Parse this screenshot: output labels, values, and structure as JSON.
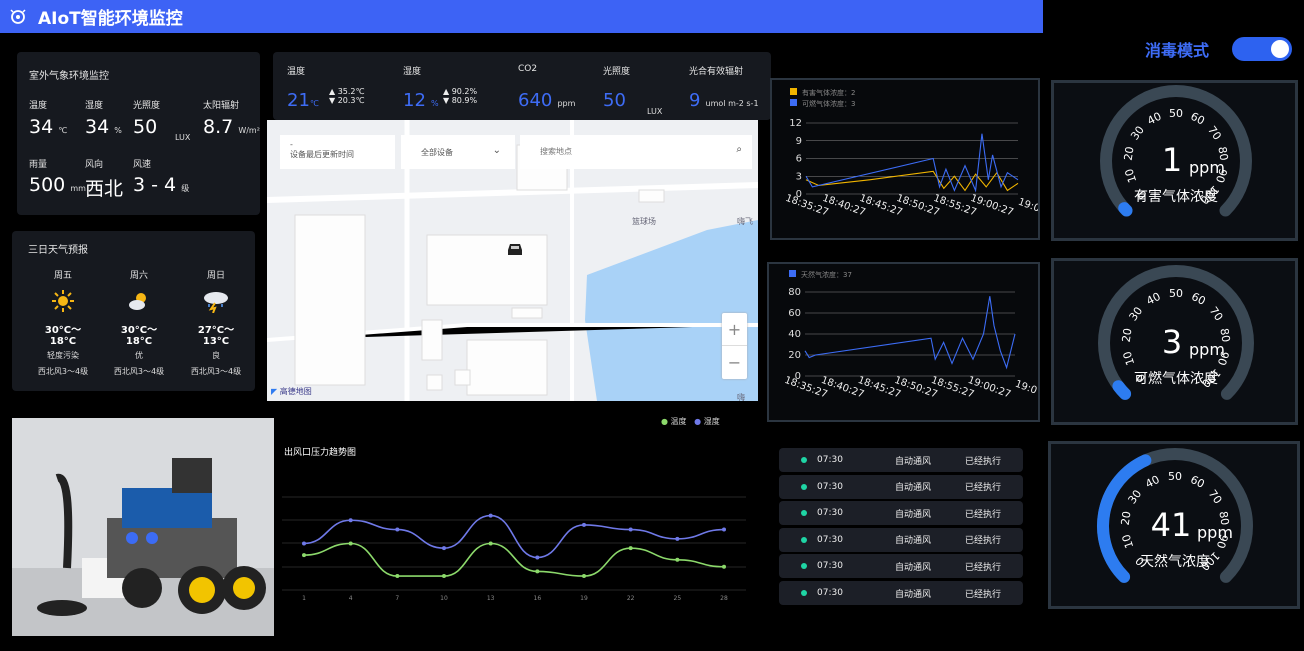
{
  "app": {
    "title": "AIoT智能环境监控"
  },
  "disinfect": {
    "label": "消毒模式",
    "on": true
  },
  "outdoor": {
    "title": "室外气象环境监控",
    "items": [
      {
        "label": "温度",
        "value": "34",
        "unit": "℃"
      },
      {
        "label": "湿度",
        "value": "34",
        "unit": "%"
      },
      {
        "label": "光照度",
        "value": "50",
        "unit": "LUX"
      },
      {
        "label": "太阳辐射",
        "value": "8.7",
        "unit": "W/m²"
      },
      {
        "label": "雨量",
        "value": "500",
        "unit": "mm"
      },
      {
        "label": "风向",
        "value": "西北",
        "unit": ""
      },
      {
        "label": "风速",
        "value": "3 - 4",
        "unit": "级"
      }
    ]
  },
  "forecast": {
    "title": "三日天气预报",
    "days": [
      {
        "day": "周五",
        "icon": "sun-icon",
        "temp": "30°C～18°C",
        "quality": "轻度污染",
        "wind": "西北风3～4级"
      },
      {
        "day": "周六",
        "icon": "partly-cloudy-icon",
        "temp": "30°C～18°C",
        "quality": "优",
        "wind": "西北风3～4级"
      },
      {
        "day": "周日",
        "icon": "thunderstorm-icon",
        "temp": "27°C～13°C",
        "quality": "良",
        "wind": "西北风3～4级"
      }
    ]
  },
  "sensors": {
    "temp": {
      "label": "温度",
      "value": "21",
      "unit": "℃",
      "high": "35.2℃",
      "low": "20.3℃"
    },
    "humidity": {
      "label": "湿度",
      "value": "12",
      "unit": "%",
      "high": "90.2%",
      "low": "80.9%"
    },
    "co2": {
      "label": "CO2",
      "value": "640",
      "unit": "ppm"
    },
    "light": {
      "label": "光照度",
      "value": "50",
      "unit": "LUX"
    },
    "par": {
      "label": "光合有效辐射",
      "value": "9",
      "unit": "umol m-2 s-1"
    }
  },
  "map": {
    "time_dash": "-",
    "time_label": "设备最后更新时间",
    "device_select": "全部设备",
    "search_placeholder": "搜索地点",
    "place1": "篮球场",
    "place2": "嗨飞",
    "place3": "嗨",
    "logo": "高德地图"
  },
  "pressure": {
    "title": "出风口压力趋势图",
    "legend": [
      "温度",
      "湿度"
    ]
  },
  "gas_chart": {
    "legend": [
      "有害气体浓度：2",
      "可燃气体浓度：3"
    ],
    "yticks": [
      "12",
      "9",
      "6",
      "3",
      "0"
    ],
    "xticks": [
      "18:35:27",
      "18:40:27",
      "18:45:27",
      "18:50:27",
      "18:55:27",
      "19:00:27",
      "19:0"
    ]
  },
  "natural_chart": {
    "legend": [
      "天然气浓度：37"
    ],
    "yticks": [
      "80",
      "60",
      "40",
      "20",
      "0"
    ],
    "xticks": [
      "18:35:27",
      "18:40:27",
      "18:45:27",
      "18:50:27",
      "18:55:27",
      "19:00:27",
      "19:0"
    ]
  },
  "logs": [
    {
      "time": "07:30",
      "action": "自动通风",
      "status": "已经执行"
    },
    {
      "time": "07:30",
      "action": "自动通风",
      "status": "已经执行"
    },
    {
      "time": "07:30",
      "action": "自动通风",
      "status": "已经执行"
    },
    {
      "time": "07:30",
      "action": "自动通风",
      "status": "已经执行"
    },
    {
      "time": "07:30",
      "action": "自动通风",
      "status": "已经执行"
    },
    {
      "time": "07:30",
      "action": "自动通风",
      "status": "已经执行"
    }
  ],
  "gauges": [
    {
      "value": "1",
      "unit": "ppm",
      "label": "有害气体浓度",
      "fraction": 0.01
    },
    {
      "value": "3",
      "unit": "ppm",
      "label": "可燃气体浓度",
      "fraction": 0.03
    },
    {
      "value": "41",
      "unit": "ppm",
      "label": "天然气浓度",
      "fraction": 0.41
    }
  ],
  "gauge_ticks": [
    "0",
    "10",
    "20",
    "30",
    "40",
    "50",
    "60",
    "70",
    "80",
    "90",
    "100"
  ],
  "chart_data": [
    {
      "type": "line",
      "title": "出风口压力趋势图",
      "x": [
        1,
        4,
        7,
        10,
        13,
        16,
        19,
        22,
        25,
        28
      ],
      "series": [
        {
          "name": "温度",
          "values": [
            45,
            50,
            36,
            36,
            50,
            38,
            36,
            48,
            43,
            40
          ],
          "color": "#8cd96b"
        },
        {
          "name": "湿度",
          "values": [
            50,
            60,
            56,
            48,
            62,
            44,
            58,
            56,
            52,
            56
          ],
          "color": "#6f79e8"
        }
      ],
      "ylim": [
        30,
        70
      ]
    },
    {
      "type": "line",
      "x": [
        "18:35:27",
        "18:40:27",
        "18:45:27",
        "18:50:27",
        "18:55:27",
        "19:00:27",
        "19:0"
      ],
      "series": [
        {
          "name": "有害气体浓度",
          "color": "#f0b400"
        },
        {
          "name": "可燃气体浓度",
          "color": "#3c6cf5"
        }
      ],
      "ylim": [
        0,
        12
      ]
    },
    {
      "type": "line",
      "x": [
        "18:35:27",
        "18:40:27",
        "18:45:27",
        "18:50:27",
        "18:55:27",
        "19:00:27",
        "19:0"
      ],
      "series": [
        {
          "name": "天然气浓度",
          "color": "#3c6cf5"
        }
      ],
      "ylim": [
        0,
        80
      ]
    }
  ]
}
